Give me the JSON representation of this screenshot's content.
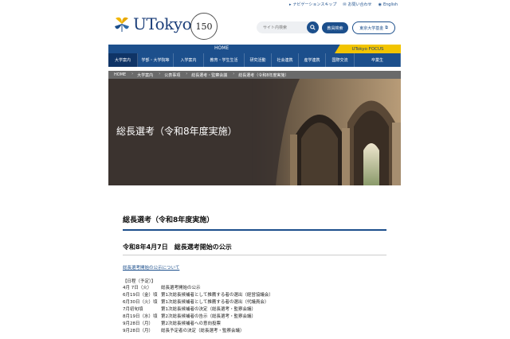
{
  "utility": {
    "nav_skip": "ナビゲーションスキップ",
    "contact": "お問い合わせ",
    "english": "English"
  },
  "logo": {
    "text": "UTokyo",
    "seal_number": "150"
  },
  "header": {
    "search_placeholder": "サイト内検索",
    "staff_search": "教員検索",
    "fund": "東京大学基金"
  },
  "homebar": {
    "label": "HOME",
    "focus": "UTokyo FOCUS"
  },
  "nav": {
    "items": [
      {
        "label": "大学案内",
        "width": 37,
        "active": true
      },
      {
        "label": "学部・大学院等",
        "width": 45
      },
      {
        "label": "入学案内",
        "width": 38
      },
      {
        "label": "教育・学生生活",
        "width": 51
      },
      {
        "label": "研究活動",
        "width": 34
      },
      {
        "label": "社会連携",
        "width": 34
      },
      {
        "label": "産学連携",
        "width": 34
      },
      {
        "label": "国際交流",
        "width": 36
      },
      {
        "label": "卒業生",
        "width": 58
      }
    ]
  },
  "breadcrumb": [
    "HOME",
    "大学案内",
    "公表事項",
    "総長選考・監察会議",
    "総長選考（令和8年度実施）"
  ],
  "hero": {
    "title": "総長選考（令和8年度実施）"
  },
  "content": {
    "h1": "総長選考（令和8年度実施）",
    "h2": "令和8年4月7日　総長選考開始の公示",
    "link": "総長選考開始の公示について",
    "schedule_head": "【日程（予定）】",
    "schedule": [
      {
        "date": "4月 7日（火）",
        "event": "総長選考開始の公示"
      },
      {
        "date": "6月19日（金）頃",
        "event": "第1次総長候補者として推薦する者の選出（経営協議会）"
      },
      {
        "date": "6月30日（火）頃",
        "event": "第1次総長候補者として推薦する者の選出（代議員会）"
      },
      {
        "date": "7月初旬頃",
        "event": "第1次総長候補者の決定（総長選考・監察会議）"
      },
      {
        "date": "8月19日（水）頃",
        "event": "第2次総長候補者の告示（総長選考・監察会議）"
      },
      {
        "date": "9月28日（月）",
        "event": "第2次総長候補者への意向投票"
      },
      {
        "date": "9月28日（月）",
        "event": "総長予定者の決定（総長選考・監察会議）"
      }
    ]
  },
  "colors": {
    "brand": "#1c4f8c",
    "focus": "#f2c400",
    "ginkgo": "#f2b600"
  }
}
